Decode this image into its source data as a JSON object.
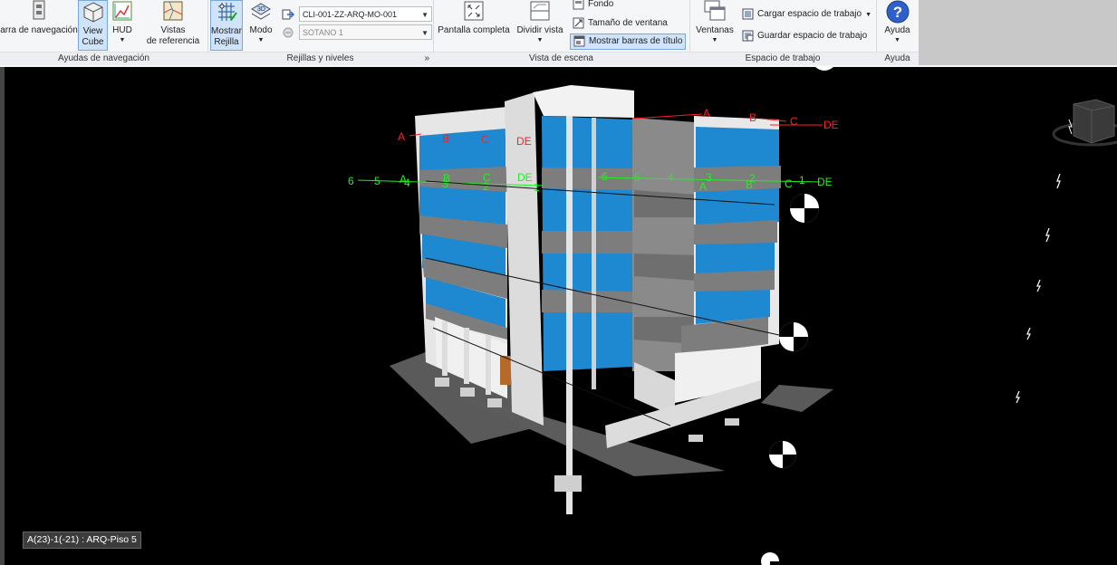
{
  "ribbon": {
    "nav_panel": {
      "title": "Ayudas de navegación",
      "nav_bar_label": "arra de navegación",
      "viewcube_label_1": "View",
      "viewcube_label_2": "Cube",
      "hud_label": "HUD",
      "ref_views_label_1": "Vistas",
      "ref_views_label_2": "de referencia"
    },
    "grid_panel": {
      "title": "Rejillas y niveles",
      "show_grid_label_1": "Mostrar",
      "show_grid_label_2": "Rejilla",
      "mode_label": "Modo",
      "model_combo_value": "CLI-001-ZZ-ARQ-MO-001",
      "level_combo_value": "SOTANO 1",
      "launcher": "»"
    },
    "scene_panel": {
      "title": "Vista de escena",
      "fullscreen_label": "Pantalla completa",
      "split_label": "Dividir vista",
      "background_label": "Fondo",
      "window_size_label": "Tamaño de ventana",
      "show_titlebars_label": "Mostrar barras de título"
    },
    "workspace_panel": {
      "title": "Espacio de trabajo",
      "windows_label": "Ventanas",
      "load_ws_label": "Cargar espacio de trabajo",
      "save_ws_label": "Guardar espacio de trabajo"
    },
    "help_panel": {
      "title": "Ayuda",
      "help_label": "Ayuda"
    }
  },
  "viewport": {
    "red_grid_labels": [
      "A",
      "B",
      "C",
      "DE",
      "A",
      "B",
      "C",
      "DE"
    ],
    "green_grid_labels": [
      "6",
      "5",
      "A",
      "4",
      "B",
      "3",
      "C",
      "2",
      "DE",
      "1",
      "6",
      "5",
      "4",
      "3",
      "A",
      "2",
      "B",
      "C",
      "1",
      "DE"
    ],
    "status_text": "A(23)-1(-21) : ARQ-Piso 5"
  },
  "colors": {
    "glass": "#1e88d0",
    "red_grid": "#ff2020",
    "green_grid": "#22ee22",
    "ribbon_bg": "#f5f6f7",
    "active_button": "#cfe3fb"
  }
}
